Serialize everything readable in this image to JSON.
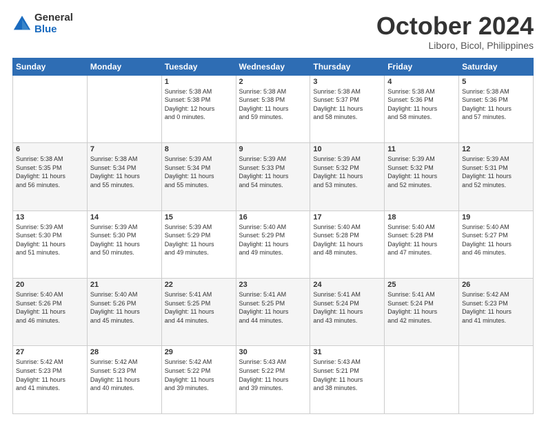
{
  "header": {
    "logo_general": "General",
    "logo_blue": "Blue",
    "month_title": "October 2024",
    "location": "Liboro, Bicol, Philippines"
  },
  "weekdays": [
    "Sunday",
    "Monday",
    "Tuesday",
    "Wednesday",
    "Thursday",
    "Friday",
    "Saturday"
  ],
  "weeks": [
    [
      {
        "day": "",
        "info": ""
      },
      {
        "day": "",
        "info": ""
      },
      {
        "day": "1",
        "info": "Sunrise: 5:38 AM\nSunset: 5:38 PM\nDaylight: 12 hours\nand 0 minutes."
      },
      {
        "day": "2",
        "info": "Sunrise: 5:38 AM\nSunset: 5:38 PM\nDaylight: 11 hours\nand 59 minutes."
      },
      {
        "day": "3",
        "info": "Sunrise: 5:38 AM\nSunset: 5:37 PM\nDaylight: 11 hours\nand 58 minutes."
      },
      {
        "day": "4",
        "info": "Sunrise: 5:38 AM\nSunset: 5:36 PM\nDaylight: 11 hours\nand 58 minutes."
      },
      {
        "day": "5",
        "info": "Sunrise: 5:38 AM\nSunset: 5:36 PM\nDaylight: 11 hours\nand 57 minutes."
      }
    ],
    [
      {
        "day": "6",
        "info": "Sunrise: 5:38 AM\nSunset: 5:35 PM\nDaylight: 11 hours\nand 56 minutes."
      },
      {
        "day": "7",
        "info": "Sunrise: 5:38 AM\nSunset: 5:34 PM\nDaylight: 11 hours\nand 55 minutes."
      },
      {
        "day": "8",
        "info": "Sunrise: 5:39 AM\nSunset: 5:34 PM\nDaylight: 11 hours\nand 55 minutes."
      },
      {
        "day": "9",
        "info": "Sunrise: 5:39 AM\nSunset: 5:33 PM\nDaylight: 11 hours\nand 54 minutes."
      },
      {
        "day": "10",
        "info": "Sunrise: 5:39 AM\nSunset: 5:32 PM\nDaylight: 11 hours\nand 53 minutes."
      },
      {
        "day": "11",
        "info": "Sunrise: 5:39 AM\nSunset: 5:32 PM\nDaylight: 11 hours\nand 52 minutes."
      },
      {
        "day": "12",
        "info": "Sunrise: 5:39 AM\nSunset: 5:31 PM\nDaylight: 11 hours\nand 52 minutes."
      }
    ],
    [
      {
        "day": "13",
        "info": "Sunrise: 5:39 AM\nSunset: 5:30 PM\nDaylight: 11 hours\nand 51 minutes."
      },
      {
        "day": "14",
        "info": "Sunrise: 5:39 AM\nSunset: 5:30 PM\nDaylight: 11 hours\nand 50 minutes."
      },
      {
        "day": "15",
        "info": "Sunrise: 5:39 AM\nSunset: 5:29 PM\nDaylight: 11 hours\nand 49 minutes."
      },
      {
        "day": "16",
        "info": "Sunrise: 5:40 AM\nSunset: 5:29 PM\nDaylight: 11 hours\nand 49 minutes."
      },
      {
        "day": "17",
        "info": "Sunrise: 5:40 AM\nSunset: 5:28 PM\nDaylight: 11 hours\nand 48 minutes."
      },
      {
        "day": "18",
        "info": "Sunrise: 5:40 AM\nSunset: 5:28 PM\nDaylight: 11 hours\nand 47 minutes."
      },
      {
        "day": "19",
        "info": "Sunrise: 5:40 AM\nSunset: 5:27 PM\nDaylight: 11 hours\nand 46 minutes."
      }
    ],
    [
      {
        "day": "20",
        "info": "Sunrise: 5:40 AM\nSunset: 5:26 PM\nDaylight: 11 hours\nand 46 minutes."
      },
      {
        "day": "21",
        "info": "Sunrise: 5:40 AM\nSunset: 5:26 PM\nDaylight: 11 hours\nand 45 minutes."
      },
      {
        "day": "22",
        "info": "Sunrise: 5:41 AM\nSunset: 5:25 PM\nDaylight: 11 hours\nand 44 minutes."
      },
      {
        "day": "23",
        "info": "Sunrise: 5:41 AM\nSunset: 5:25 PM\nDaylight: 11 hours\nand 44 minutes."
      },
      {
        "day": "24",
        "info": "Sunrise: 5:41 AM\nSunset: 5:24 PM\nDaylight: 11 hours\nand 43 minutes."
      },
      {
        "day": "25",
        "info": "Sunrise: 5:41 AM\nSunset: 5:24 PM\nDaylight: 11 hours\nand 42 minutes."
      },
      {
        "day": "26",
        "info": "Sunrise: 5:42 AM\nSunset: 5:23 PM\nDaylight: 11 hours\nand 41 minutes."
      }
    ],
    [
      {
        "day": "27",
        "info": "Sunrise: 5:42 AM\nSunset: 5:23 PM\nDaylight: 11 hours\nand 41 minutes."
      },
      {
        "day": "28",
        "info": "Sunrise: 5:42 AM\nSunset: 5:23 PM\nDaylight: 11 hours\nand 40 minutes."
      },
      {
        "day": "29",
        "info": "Sunrise: 5:42 AM\nSunset: 5:22 PM\nDaylight: 11 hours\nand 39 minutes."
      },
      {
        "day": "30",
        "info": "Sunrise: 5:43 AM\nSunset: 5:22 PM\nDaylight: 11 hours\nand 39 minutes."
      },
      {
        "day": "31",
        "info": "Sunrise: 5:43 AM\nSunset: 5:21 PM\nDaylight: 11 hours\nand 38 minutes."
      },
      {
        "day": "",
        "info": ""
      },
      {
        "day": "",
        "info": ""
      }
    ]
  ]
}
